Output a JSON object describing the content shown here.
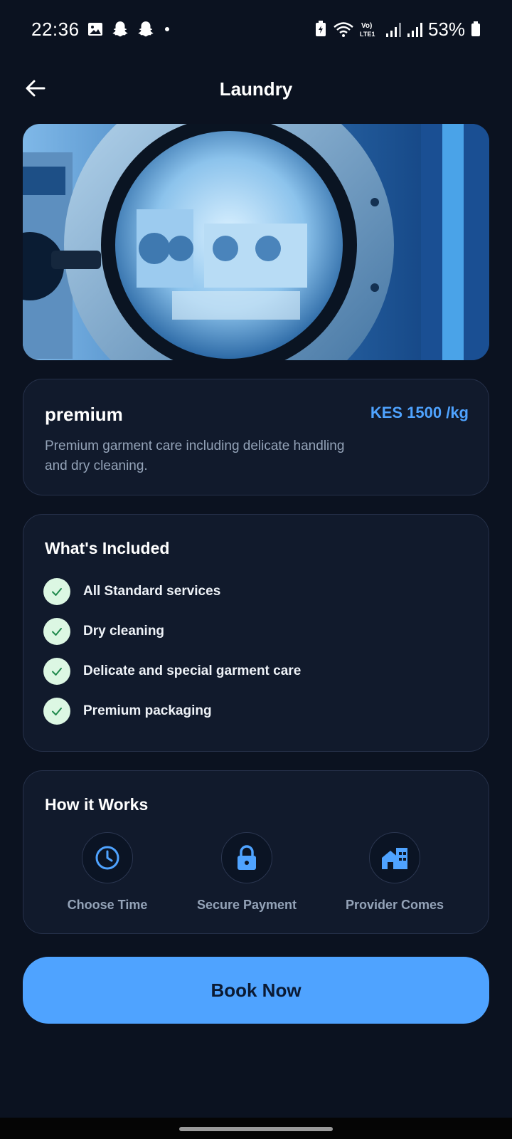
{
  "status_bar": {
    "time": "22:36",
    "lte_label": "Vo) LTE1",
    "battery_percent": "53%"
  },
  "header": {
    "title": "Laundry",
    "back_icon": "arrow-left-icon"
  },
  "hero": {
    "image_icon": "washing-machine-photo"
  },
  "plan": {
    "name": "premium",
    "price": "KES 1500 /kg",
    "description": "Premium garment care including delicate handling and dry cleaning."
  },
  "included": {
    "title": "What's Included",
    "items": [
      {
        "label": "All Standard services"
      },
      {
        "label": "Dry cleaning"
      },
      {
        "label": "Delicate and special garment care"
      },
      {
        "label": "Premium packaging"
      }
    ]
  },
  "how_it_works": {
    "title": "How it Works",
    "steps": [
      {
        "label": "Choose Time",
        "icon": "clock-icon"
      },
      {
        "label": "Secure Payment",
        "icon": "lock-icon"
      },
      {
        "label": "Provider Comes",
        "icon": "house-icon"
      }
    ]
  },
  "actions": {
    "book_label": "Book Now"
  },
  "colors": {
    "background": "#0b1220",
    "card": "#111a2c",
    "accent": "#4fa3ff",
    "check_bg": "#dcf7e3",
    "check": "#1f8a4c"
  }
}
